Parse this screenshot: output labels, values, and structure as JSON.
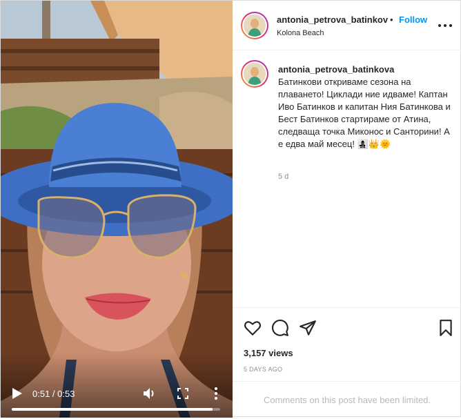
{
  "post": {
    "username": "antonia_petrova_batinkova",
    "header_username": "antonia_petrova_batinkov",
    "separator": "•",
    "follow_label": "Follow",
    "location": "Kolona Beach",
    "caption": "Батинкови откриваме сезона на плаването! Циклади ние идваме! Каптан Иво Батинков и капитан Ния Батинкова и Бест Батинков стартираме от Атина, следваща точка Миконос и Санторини! А е едва май месец! 👩‍👧‍👦👑🌞",
    "caption_age": "5 d",
    "views": "3,157 views",
    "posted": "5 DAYS AGO",
    "comments_notice": "Comments on this post have been limited."
  },
  "video": {
    "time": "0:51 / 0:53",
    "progress": 0.962
  },
  "icons": {
    "header_more": "more-horizontal-icon",
    "like": "heart-icon",
    "comment": "comment-icon",
    "share": "paper-plane-icon",
    "save": "bookmark-icon",
    "play": "play-icon",
    "volume": "volume-icon",
    "fullscreen": "fullscreen-icon",
    "video_more": "more-vertical-icon"
  },
  "colors": {
    "accent": "#0095f6",
    "text": "#262626",
    "muted": "#8e8e8e",
    "hat_blue": "#3e6fc4"
  }
}
